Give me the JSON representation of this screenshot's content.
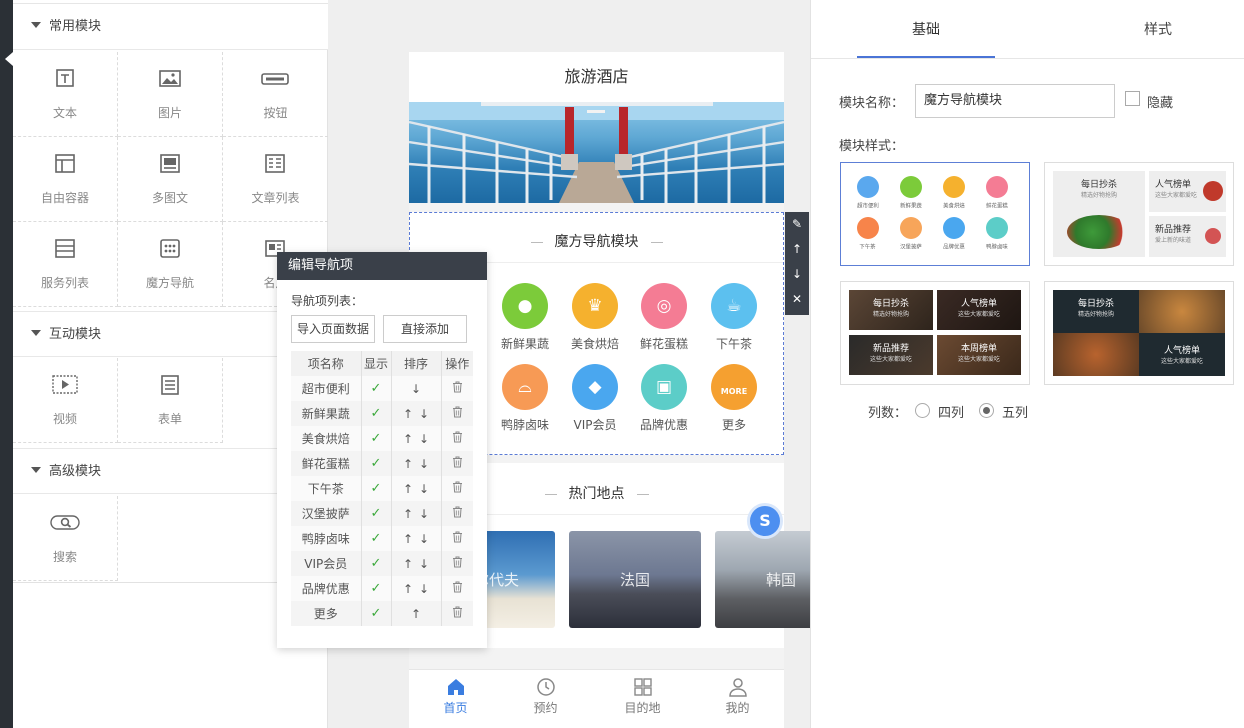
{
  "left_panel": {
    "sections": [
      {
        "title": "常用模块",
        "items": [
          "文本",
          "图片",
          "按钮",
          "自由容器",
          "多图文",
          "文章列表",
          "服务列表",
          "魔方导航",
          "名片"
        ]
      },
      {
        "title": "互动模块",
        "items": [
          "视频",
          "表单"
        ]
      },
      {
        "title": "高级模块",
        "items": [
          "搜索"
        ]
      }
    ]
  },
  "phone": {
    "title": "旅游酒店",
    "nav_module": {
      "title": "魔方导航模块",
      "items": [
        {
          "label": "新鲜果蔬",
          "icon": "apple-icon",
          "color": "#7ccb3a"
        },
        {
          "label": "美食烘焙",
          "icon": "cupcake-icon",
          "color": "#f5b12e"
        },
        {
          "label": "鲜花蛋糕",
          "icon": "donut-icon",
          "color": "#f47c94"
        },
        {
          "label": "下午茶",
          "icon": "coffee-cup-icon",
          "color": "#5cc0ef"
        },
        {
          "label": "鸭脖卤味",
          "icon": "dish-cover-icon",
          "color": "#f79a55"
        },
        {
          "label": "VIP会员",
          "icon": "diamond-icon",
          "color": "#4aa7ef"
        },
        {
          "label": "品牌优惠",
          "icon": "gift-icon",
          "color": "#5ccdc8"
        },
        {
          "label": "更多",
          "icon": "more-icon",
          "badge": "MORE",
          "color": "#f5a030"
        }
      ]
    },
    "hot_module": {
      "title": "热门地点",
      "photos": [
        "马尔代夫",
        "法国",
        "韩国"
      ]
    },
    "tabbar": [
      {
        "label": "首页",
        "icon": "home-icon",
        "active": true
      },
      {
        "label": "预约",
        "icon": "clock-icon",
        "active": false
      },
      {
        "label": "目的地",
        "icon": "grid-icon",
        "active": false
      },
      {
        "label": "我的",
        "icon": "user-icon",
        "active": false
      }
    ]
  },
  "toolbar_icons": [
    "edit-pencil-icon",
    "move-up-icon",
    "move-down-icon",
    "close-icon"
  ],
  "popup": {
    "title": "编辑导航项",
    "list_label": "导航项列表：",
    "import_button": "导入页面数据",
    "add_button": "直接添加",
    "columns": [
      "项名称",
      "显示",
      "排序",
      "操作"
    ],
    "rows": [
      {
        "name": "超市便利",
        "up": false,
        "down": true
      },
      {
        "name": "新鲜果蔬",
        "up": true,
        "down": true
      },
      {
        "name": "美食烘焙",
        "up": true,
        "down": true
      },
      {
        "name": "鲜花蛋糕",
        "up": true,
        "down": true
      },
      {
        "name": "下午茶",
        "up": true,
        "down": true
      },
      {
        "name": "汉堡披萨",
        "up": true,
        "down": true
      },
      {
        "name": "鸭脖卤味",
        "up": true,
        "down": true
      },
      {
        "name": "VIP会员",
        "up": true,
        "down": true
      },
      {
        "name": "品牌优惠",
        "up": true,
        "down": true
      },
      {
        "name": "更多",
        "up": true,
        "down": false
      }
    ]
  },
  "right_panel": {
    "tabs": [
      {
        "label": "基础",
        "active": true
      },
      {
        "label": "样式",
        "active": false
      }
    ],
    "module_name_label": "模块名称：",
    "module_name_value": "魔方导航模块",
    "hide_label": "隐藏",
    "style_label": "模块样式：",
    "style1_items": [
      {
        "label": "超市便利",
        "color": "#5aa8ee"
      },
      {
        "label": "新鲜果蔬",
        "color": "#7ccb3a"
      },
      {
        "label": "美食烘焙",
        "color": "#f5b12e"
      },
      {
        "label": "鲜花蛋糕",
        "color": "#f47c94"
      },
      {
        "label": "下午茶",
        "color": "#f7844a"
      },
      {
        "label": "汉堡披萨",
        "color": "#f7a55a"
      },
      {
        "label": "品牌优惠",
        "color": "#4aa7ef"
      },
      {
        "label": "鸭脖卤味",
        "color": "#5ccdc8"
      }
    ],
    "style2": {
      "a_title": "每日抄杀",
      "a_sub": "精选好物抢购",
      "b_title": "人气榜单",
      "b_sub": "这些大家都爱吃",
      "c_title": "新品推荐",
      "c_sub": "爱上新的味道"
    },
    "style3": [
      {
        "title": "每日抄杀",
        "sub": "精选好物抢购"
      },
      {
        "title": "人气榜单",
        "sub": "这些大家都爱吃"
      },
      {
        "title": "新品推荐",
        "sub": "这些大家都爱吃"
      },
      {
        "title": "本周榜单",
        "sub": "这些大家都爱吃"
      }
    ],
    "style4": [
      {
        "title": "每日抄杀",
        "sub": "精选好物抢购"
      },
      {
        "title": "人气榜单",
        "sub": "这些大家都爱吃"
      }
    ],
    "columns_label": "列数：",
    "columns_options": [
      {
        "label": "四列",
        "selected": false
      },
      {
        "label": "五列",
        "selected": true
      }
    ]
  },
  "colors": {
    "accent": "#4a74d6",
    "dark": "#3a4049",
    "check": "#3aa83a"
  }
}
